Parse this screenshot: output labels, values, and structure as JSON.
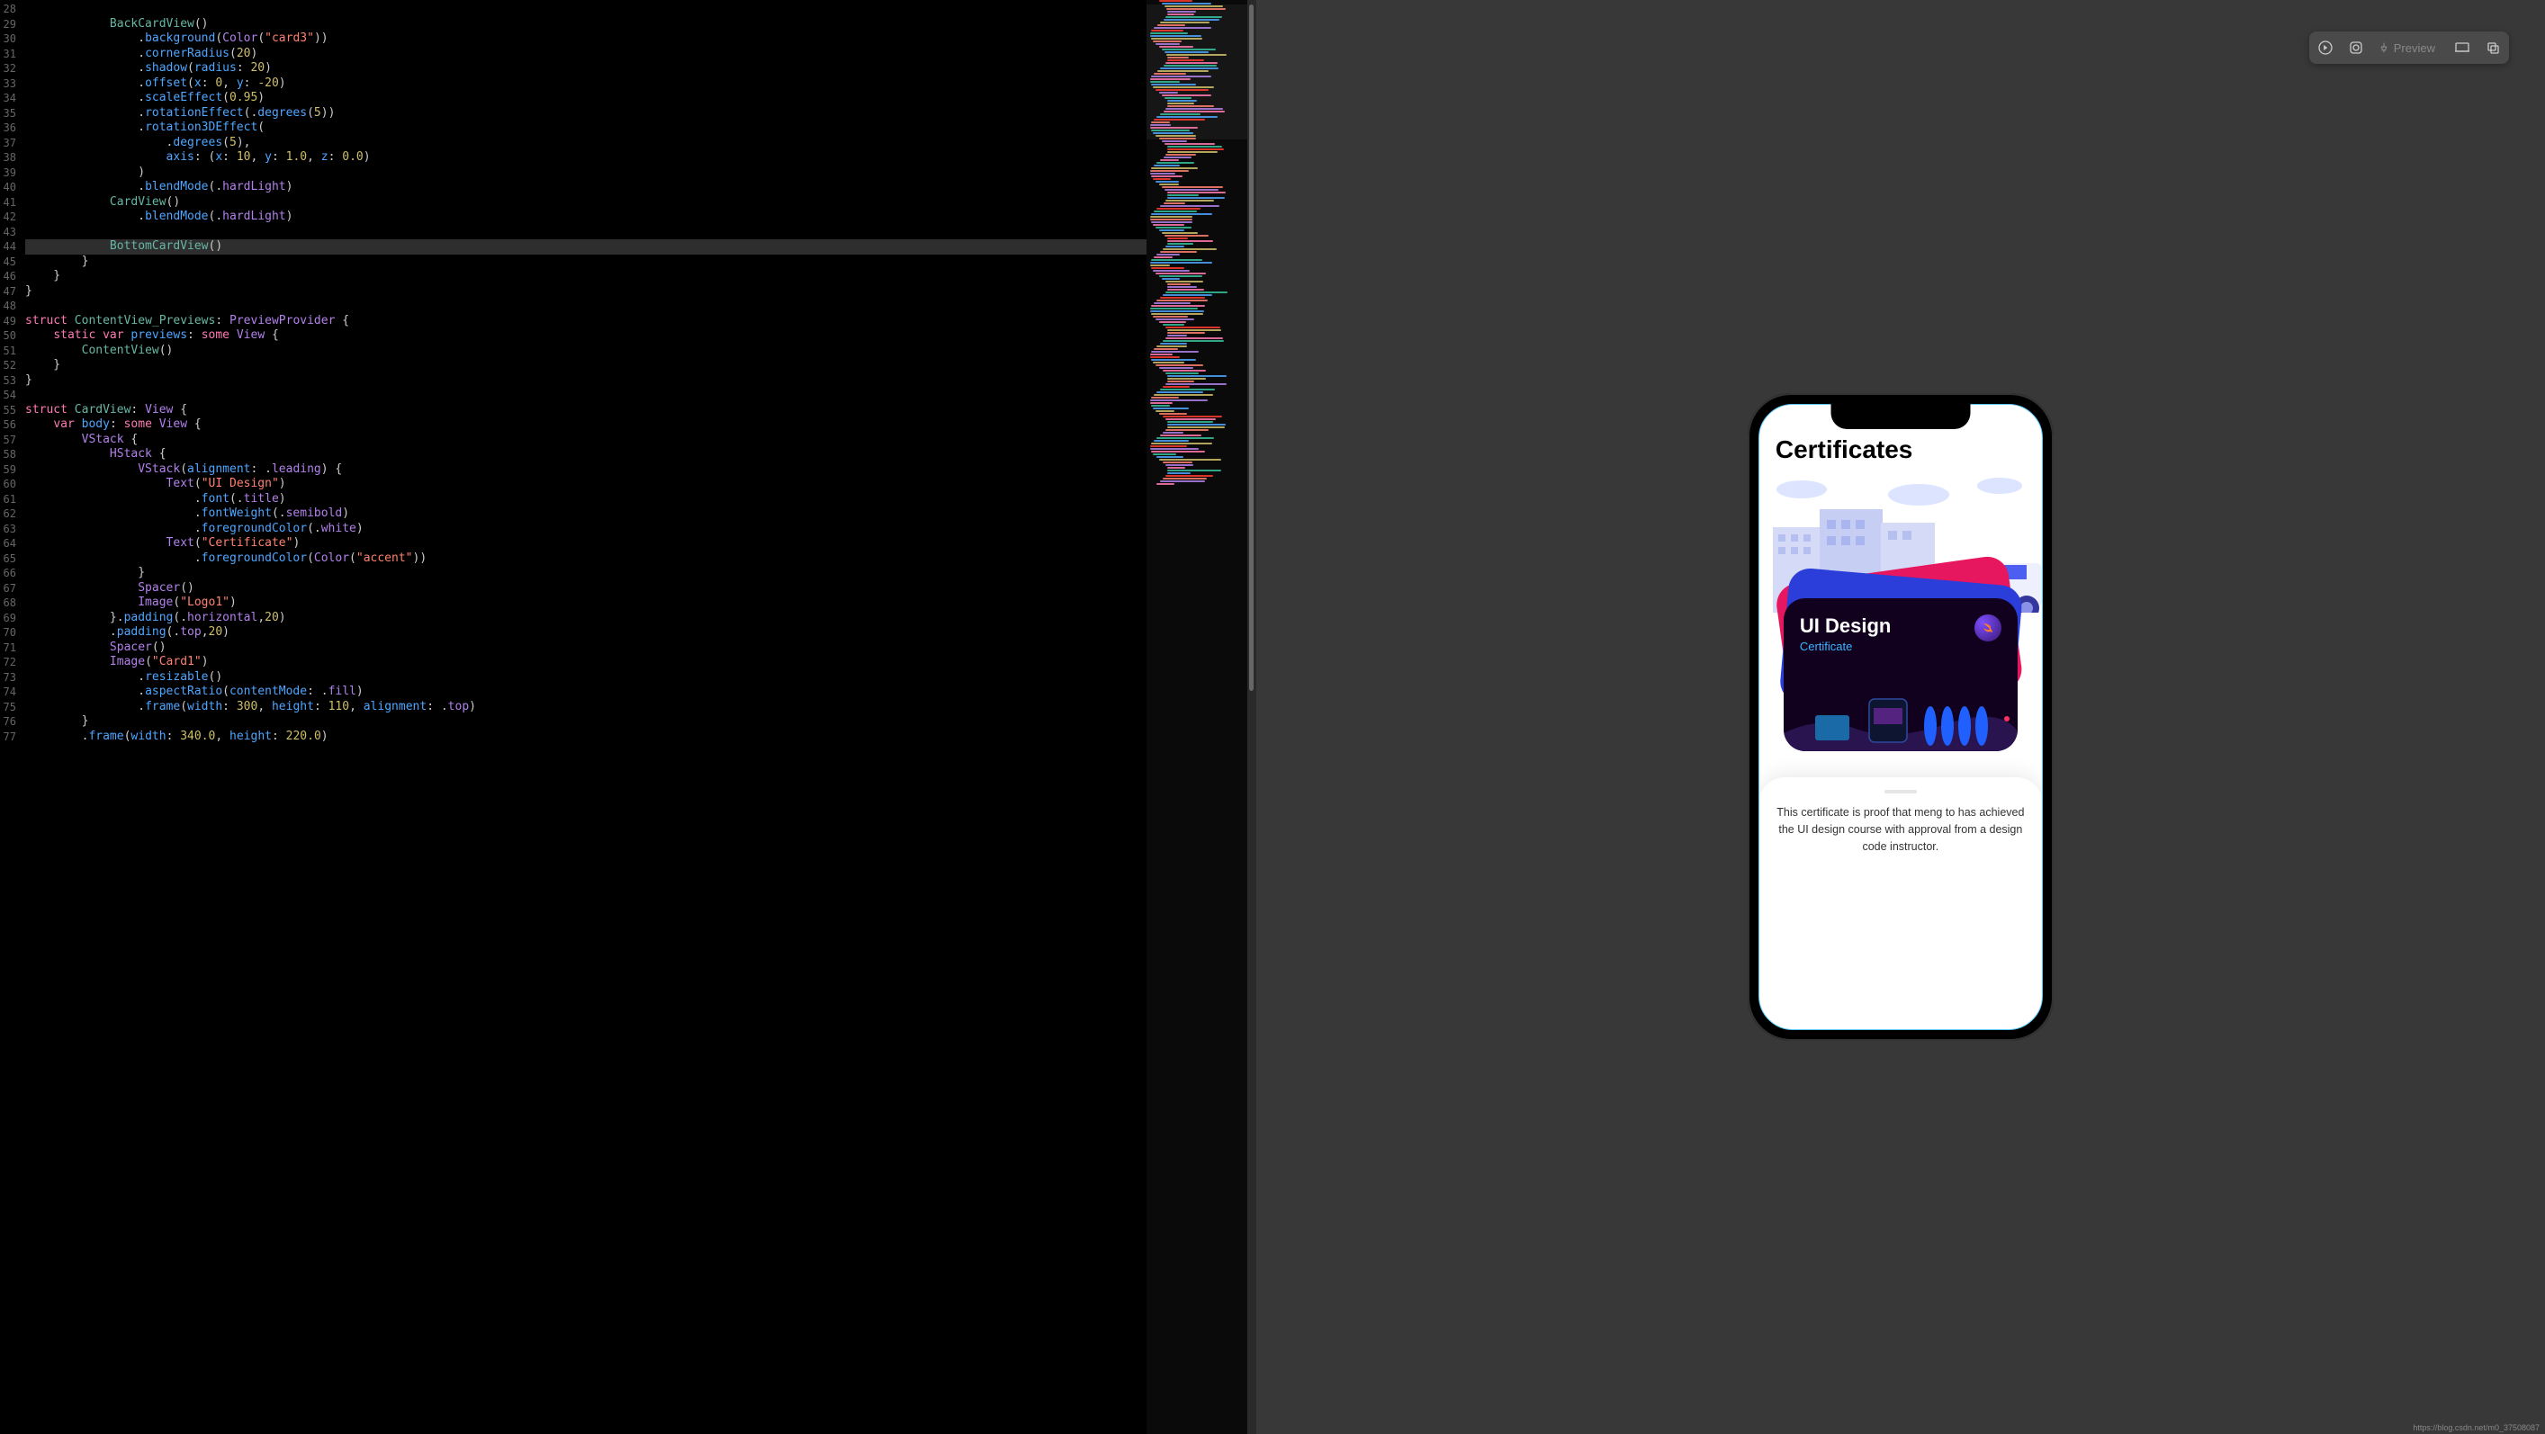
{
  "lineStart": 28,
  "lineCount": 50,
  "highlightedLine": 44,
  "code": [
    "",
    "            BackCardView()",
    "                .background(Color(\"card3\"))",
    "                .cornerRadius(20)",
    "                .shadow(radius: 20)",
    "                .offset(x: 0, y: -20)",
    "                .scaleEffect(0.95)",
    "                .rotationEffect(.degrees(5))",
    "                .rotation3DEffect(",
    "                    .degrees(5),",
    "                    axis: (x: 10, y: 1.0, z: 0.0)",
    "                )",
    "                .blendMode(.hardLight)",
    "            CardView()",
    "                .blendMode(.hardLight)",
    "",
    "            BottomCardView()",
    "        }",
    "    }",
    "}",
    "",
    "struct ContentView_Previews: PreviewProvider {",
    "    static var previews: some View {",
    "        ContentView()",
    "    }",
    "}",
    "",
    "struct CardView: View {",
    "    var body: some View {",
    "        VStack {",
    "            HStack {",
    "                VStack(alignment: .leading) {",
    "                    Text(\"UI Design\")",
    "                        .font(.title)",
    "                        .fontWeight(.semibold)",
    "                        .foregroundColor(.white)",
    "                    Text(\"Certificate\")",
    "                        .foregroundColor(Color(\"accent\"))",
    "                }",
    "                Spacer()",
    "                Image(\"Logo1\")",
    "            }.padding(.horizontal,20)",
    "            .padding(.top,20)",
    "            Spacer()",
    "            Image(\"Card1\")",
    "                .resizable()",
    "                .aspectRatio(contentMode: .fill)",
    "                .frame(width: 300, height: 110, alignment: .top)",
    "        }",
    "        .frame(width: 340.0, height: 220.0)"
  ],
  "toolbar": {
    "previewLabel": "Preview"
  },
  "preview": {
    "headerTitle": "Certificates",
    "cardTitle": "UI Design",
    "cardSubtitle": "Certificate",
    "sheetText": "This certificate is proof that meng to has achieved the UI design course with approval from a design code instructor."
  },
  "watermark": "https://blog.csdn.net/m0_37508087"
}
